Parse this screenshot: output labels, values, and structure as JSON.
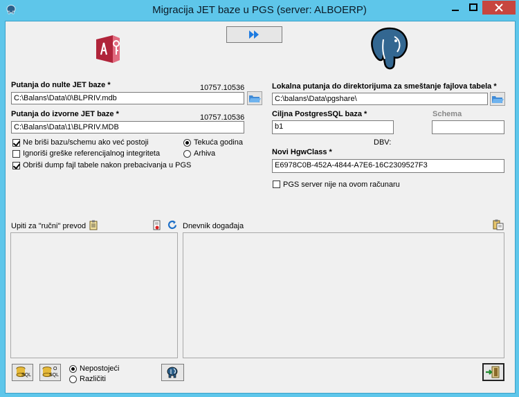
{
  "window": {
    "title": "Migracija JET baze u PGS (server: ALBOERP)"
  },
  "left": {
    "source_null_label": "Putanja do nulte JET baze *",
    "source_null_count": "10757.10536",
    "source_null_value": "C:\\Balans\\Data\\0\\BLPRIV.mdb",
    "source_src_label": "Putanja do izvorne JET baze *",
    "source_src_count": "10757.10536",
    "source_src_value": "C:\\Balans\\Data\\1\\BLPRIV.MDB",
    "options": [
      {
        "label": "Ne briši bazu/schemu ako već postoji",
        "checked": true
      },
      {
        "label": "Ignoriši greške referencijalnog integriteta",
        "checked": false
      },
      {
        "label": "Obriši dump fajl tabele nakon prebacivanja u PGS",
        "checked": true
      }
    ],
    "year_options": [
      {
        "label": "Tekuća godina",
        "selected": true
      },
      {
        "label": "Arhiva",
        "selected": false
      }
    ]
  },
  "right": {
    "local_path_label": "Lokalna putanja do direktorijuma za smeštanje fajlova tabela *",
    "local_path_value": "C:\\balans\\Data\\pgshare\\",
    "target_db_label": "Ciljna PostgresSQL baza *",
    "target_db_value": "b1",
    "schema_label": "Schema",
    "schema_value": "",
    "dbv_label": "DBV:",
    "hgw_label": "Novi HgwClass *",
    "hgw_value": "E6978C0B-452A-4844-A7E6-16C2309527F3",
    "pgs_not_local_label": "PGS server nije na ovom računaru",
    "pgs_not_local_checked": false
  },
  "bottom": {
    "queries_label": "Upiti za \"ručni\" prevod",
    "log_label": "Dnevnik događaja",
    "diff_options": [
      {
        "label": "Nepostojeći",
        "selected": true
      },
      {
        "label": "Različiti",
        "selected": false
      }
    ],
    "sql_btn_text": "SQL",
    "osql_btn_top": "O",
    "osql_btn_bottom": "SQL"
  },
  "colors": {
    "titlebar": "#5ec6ea",
    "close_button": "#c7463f",
    "access_logo": "#b0243a",
    "elephant": "#336791"
  }
}
